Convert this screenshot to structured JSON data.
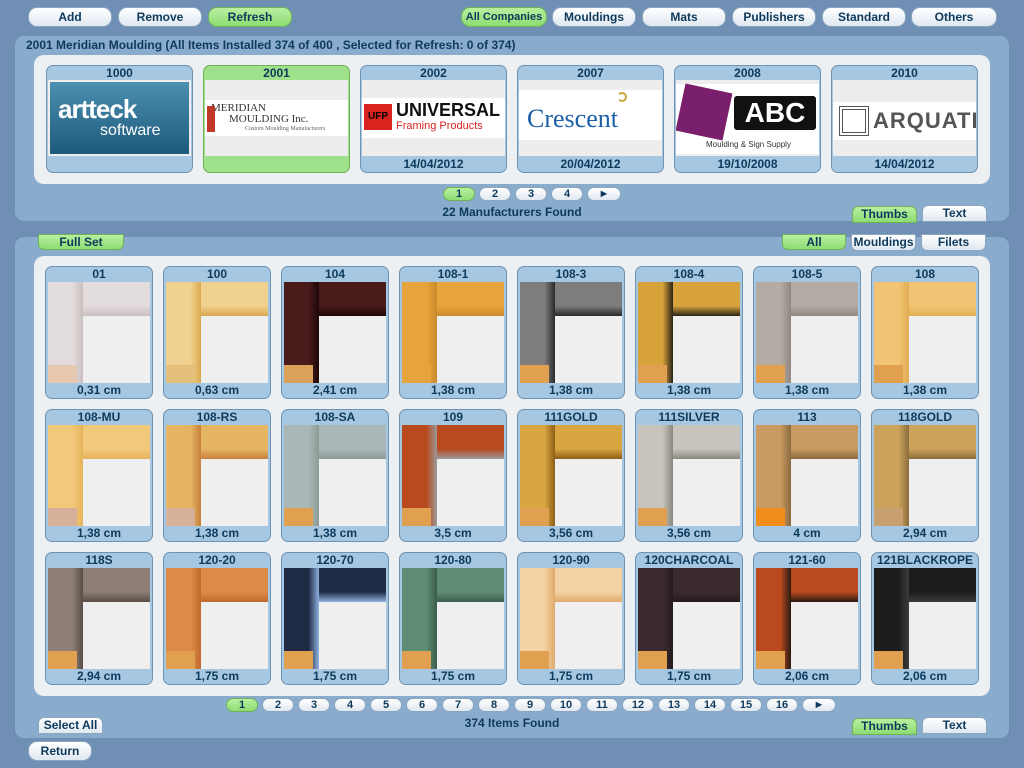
{
  "toolbar": {
    "add": "Add",
    "remove": "Remove",
    "refresh": "Refresh",
    "all_companies": "All Companies",
    "mouldings": "Mouldings",
    "mats": "Mats",
    "publishers": "Publishers",
    "standard": "Standard",
    "others": "Others"
  },
  "manufacturers_panel": {
    "status": "2001 Meridian Moulding (All Items Installed 374 of 400 , Selected for Refresh: 0 of 374)",
    "found": "22 Manufacturers Found",
    "thumbs": "Thumbs",
    "text": "Text",
    "pages": [
      "1",
      "2",
      "3",
      "4",
      "►"
    ],
    "active_page": 0,
    "cards": [
      {
        "code": "1000",
        "logo": "artteck-software-logo",
        "logo_text": [
          "artteck",
          "software"
        ],
        "date": "",
        "selected": false
      },
      {
        "code": "2001",
        "logo": "meridian-moulding-logo",
        "logo_text": [
          "MERIDIAN",
          "MOULDING Inc.",
          "Custom Moulding Manufacturers"
        ],
        "date": "",
        "selected": true
      },
      {
        "code": "2002",
        "logo": "universal-framing-logo",
        "logo_text": [
          "UFP",
          "UNIVERSAL",
          "Framing Products"
        ],
        "date": "14/04/2012",
        "selected": false
      },
      {
        "code": "2007",
        "logo": "crescent-logo",
        "logo_text": [
          "Crescent"
        ],
        "date": "20/04/2012",
        "selected": false
      },
      {
        "code": "2008",
        "logo": "abc-moulding-logo",
        "logo_text": [
          "ABC",
          "Moulding & Sign Supply"
        ],
        "date": "19/10/2008",
        "selected": false
      },
      {
        "code": "2010",
        "logo": "arquati-logo",
        "logo_text": [
          "ARQUATI"
        ],
        "date": "14/04/2012",
        "selected": false
      }
    ]
  },
  "items_panel": {
    "full_set": "Full Set",
    "filter_all": "All",
    "filter_mouldings": "Mouldings",
    "filter_filets": "Filets",
    "found": "374 Items Found",
    "select_all": "Select All",
    "thumbs": "Thumbs",
    "text": "Text",
    "pages": [
      "1",
      "2",
      "3",
      "4",
      "5",
      "6",
      "7",
      "8",
      "9",
      "10",
      "11",
      "12",
      "13",
      "14",
      "15",
      "16",
      "►"
    ],
    "active_page": 0,
    "items": [
      {
        "code": "01",
        "width": "0,31 cm",
        "face": "#e3dcdc",
        "edge": "#c9bfbf",
        "base": "#e6c8b0"
      },
      {
        "code": "100",
        "width": "0,63 cm",
        "face": "#f1d18f",
        "edge": "#d9a84e",
        "base": "#e3bf7a"
      },
      {
        "code": "104",
        "width": "2,41 cm",
        "face": "#4a1b1b",
        "edge": "#1e0808",
        "base": "#d9a15a"
      },
      {
        "code": "108-1",
        "width": "1,38 cm",
        "face": "#e8a43c",
        "edge": "#c98a2c",
        "base": "#e8a43c"
      },
      {
        "code": "108-3",
        "width": "1,38 cm",
        "face": "#7d7d7d",
        "edge": "#2a2a2a",
        "base": "#e0a050"
      },
      {
        "code": "108-4",
        "width": "1,38 cm",
        "face": "#d8a23b",
        "edge": "#2c2418",
        "base": "#e0a050"
      },
      {
        "code": "108-5",
        "width": "1,38 cm",
        "face": "#b4aba5",
        "edge": "#8f8780",
        "base": "#e0a050"
      },
      {
        "code": "108",
        "width": "1,38 cm",
        "face": "#f0c474",
        "edge": "#e3ad55",
        "base": "#e0a050"
      },
      {
        "code": "108-MU",
        "width": "1,38 cm",
        "face": "#f2c87a",
        "edge": "#e6b35c",
        "base": "#d6b09a"
      },
      {
        "code": "108-RS",
        "width": "1,38 cm",
        "face": "#e6b562",
        "edge": "#c6803c",
        "base": "#d6b09a"
      },
      {
        "code": "108-SA",
        "width": "1,38 cm",
        "face": "#a9b8b6",
        "edge": "#8b9b95",
        "base": "#e0a050"
      },
      {
        "code": "109",
        "width": "3,5 cm",
        "face": "#b84a1d",
        "edge": "#9a9a9a",
        "base": "#e0a050"
      },
      {
        "code": "111GOLD",
        "width": "3,56 cm",
        "face": "#d9a540",
        "edge": "#8e5f18",
        "base": "#e0a050"
      },
      {
        "code": "111SILVER",
        "width": "3,56 cm",
        "face": "#c7c4bd",
        "edge": "#8a877f",
        "base": "#e0a050"
      },
      {
        "code": "113",
        "width": "4 cm",
        "face": "#c99b63",
        "edge": "#8a6a3f",
        "base": "#f08c1a"
      },
      {
        "code": "118GOLD",
        "width": "2,94 cm",
        "face": "#cda35c",
        "edge": "#8a6c3a",
        "base": "#c8a070"
      },
      {
        "code": "118S",
        "width": "2,94 cm",
        "face": "#8d7f75",
        "edge": "#5a4d45",
        "base": "#e0a050"
      },
      {
        "code": "120-20",
        "width": "1,75 cm",
        "face": "#de8a49",
        "edge": "#c06a2c",
        "base": "#e0a050"
      },
      {
        "code": "120-70",
        "width": "1,75 cm",
        "face": "#1f2a44",
        "edge": "#8fb2e0",
        "base": "#e0a050"
      },
      {
        "code": "120-80",
        "width": "1,75 cm",
        "face": "#5f8c74",
        "edge": "#3a5e4b",
        "base": "#e0a050"
      },
      {
        "code": "120-90",
        "width": "1,75 cm",
        "face": "#f3d2a3",
        "edge": "#e0a96c",
        "base": "#e0a050"
      },
      {
        "code": "120CHARCOAL",
        "width": "1,75 cm",
        "face": "#3b2a2e",
        "edge": "#261a1d",
        "base": "#e0a050"
      },
      {
        "code": "121-60",
        "width": "2,06 cm",
        "face": "#b84a1d",
        "edge": "#2a1a12",
        "base": "#e0a050"
      },
      {
        "code": "121BLACKROPE",
        "width": "2,06 cm",
        "face": "#1c1c1c",
        "edge": "#3b3b3b",
        "base": "#e0a050"
      }
    ]
  },
  "footer": {
    "return": "Return"
  },
  "colors": {
    "background": "#6f8fb4",
    "panel": "#8aaccc",
    "active_green": "#9fe08a",
    "card_blue": "#a6c7e1",
    "text": "#0d3a5c"
  }
}
